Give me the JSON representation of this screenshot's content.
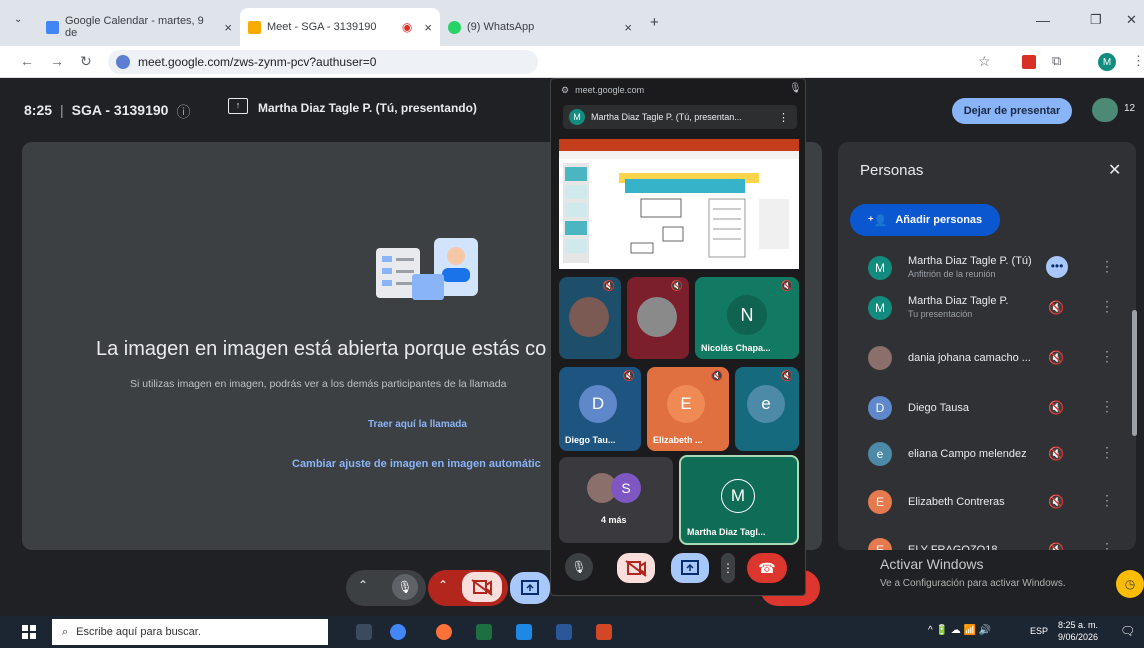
{
  "browser": {
    "tabs": [
      {
        "label": "Google Calendar - martes, 9 de",
        "color": "#4285f4"
      },
      {
        "label": "Meet - SGA - 3139190",
        "color": "#f9ab00"
      },
      {
        "label": "(9) WhatsApp",
        "color": "#25d366"
      }
    ],
    "close": "×",
    "new_tab": "+",
    "url": "meet.google.com/zws-zynm-pcv?authuser=0",
    "profile_initial": "M",
    "minimize": "—",
    "restore": "❐",
    "close_window": "✕"
  },
  "meet": {
    "time": "8:25",
    "separator": "|",
    "meeting_code": "SGA - 3139190",
    "presenting_label": "Martha Diaz Tagle P. (Tú, presentando)",
    "stop_presenting": "Dejar de presentar",
    "participant_count": "12",
    "pip_heading": "La imagen en imagen está abierta porque estás co",
    "pip_desc": "Si utilizas imagen en imagen, podrás ver a los demás participantes de la llamada",
    "bring_call": "Traer aquí la llamada",
    "change_setting": "Cambiar ajuste de imagen en imagen automátic"
  },
  "people_panel": {
    "title": "Personas",
    "close": "✕",
    "add_button": "Añadir personas",
    "participants": [
      {
        "initial": "M",
        "name": "Martha Diaz Tagle P. (Tú)",
        "sub": "Anfitrión de la reunión",
        "color": "#128c7e"
      },
      {
        "initial": "M",
        "name": "Martha Diaz Tagle P.",
        "sub": "Tu presentación",
        "color": "#128c7e"
      },
      {
        "initial": "",
        "name": "dania johana camacho ...",
        "sub": "",
        "color": "#8a6f6a"
      },
      {
        "initial": "D",
        "name": "Diego Tausa",
        "sub": "",
        "color": "#5e88c9"
      },
      {
        "initial": "e",
        "name": "eliana Campo melendez",
        "sub": "",
        "color": "#4c8aa8"
      },
      {
        "initial": "E",
        "name": "Elizabeth Contreras",
        "sub": "",
        "color": "#e67a4f"
      },
      {
        "initial": "E",
        "name": "ELY FRAGOZO18",
        "sub": "",
        "color": "#e67a4f"
      }
    ]
  },
  "pip_window": {
    "domain": "meet.google.com",
    "presenter": "Martha Diaz Tagle P. (Tú, presentan...",
    "presenter_initial": "M",
    "tiles": [
      {
        "initial": "N",
        "name": "Nicolás Chapa...",
        "color": "#127a62"
      },
      {
        "initial": "D",
        "name": "Diego Tau...",
        "color": "#1e5580"
      },
      {
        "initial": "E",
        "name": "Elizabeth ...",
        "color": "#e0703f"
      },
      {
        "initial": "e",
        "name": "",
        "color": "#156a7e"
      },
      {
        "initial": "S",
        "name": "4 más",
        "color": "#3a3a3e"
      },
      {
        "initial": "M",
        "name": "Martha Diaz Tagl...",
        "color": "#0f6d56"
      }
    ]
  },
  "windows": {
    "activate_title": "Activar Windows",
    "activate_sub": "Ve a Configuración para activar Windows.",
    "search_placeholder": "Escribe aquí para buscar.",
    "time": "8:25 a. m.",
    "date": "9/06/2026",
    "lang": "ESP"
  }
}
